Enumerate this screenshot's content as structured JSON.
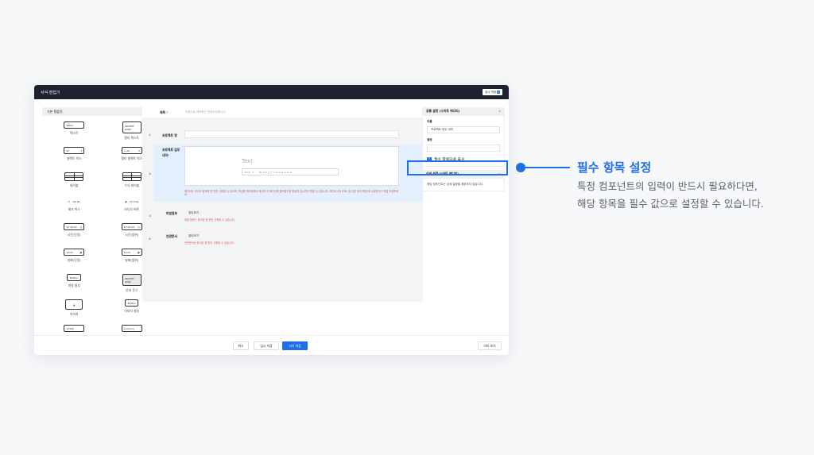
{
  "window": {
    "title": "서식 편집기",
    "top_button": {
      "label": "임시 저장",
      "badge": "0"
    }
  },
  "left_panel": {
    "title": "기본 템플릿",
    "components": [
      {
        "icon_text": "ABCD",
        "label": "텍스트"
      },
      {
        "icon_text": "ABCDEF GHIJK",
        "label": "멀티 텍스트"
      },
      {
        "icon_text": "All",
        "label": "셀렉트 박스"
      },
      {
        "icon_text": "All",
        "label": "멀티 셀렉트 박스"
      },
      {
        "icon_text": "",
        "label": "테이블"
      },
      {
        "icon_text": "",
        "label": "수식 테이블"
      },
      {
        "icon_text": "Yes  No",
        "label": "체크 박스"
      },
      {
        "icon_text": "All  Only",
        "label": "라디오 버튼"
      },
      {
        "icon_text": "12:30:00",
        "label": "시간(단일)"
      },
      {
        "icon_text": "12:30:00",
        "label": "시간(범위)"
      },
      {
        "icon_text": "12/31",
        "label": "날짜(단일)"
      },
      {
        "icon_text": "12/31",
        "label": "날짜(범위)"
      },
      {
        "icon_text": "Button",
        "label": "파일 첨부"
      },
      {
        "icon_text": "ABCDEF GHIJK",
        "label": "안내 문구"
      },
      {
        "icon_text": "",
        "label": "이미지"
      },
      {
        "icon_text": "Button",
        "label": "이미지 첨부"
      },
      {
        "icon_text": "1234$",
        "label": ""
      },
      {
        "icon_text": "Currency",
        "label": ""
      }
    ]
  },
  "form": {
    "title_label": "제목",
    "title_required": "*",
    "title_placeholder": "지원으로 제목부는 표현으로합니다.",
    "rows": [
      {
        "num": "①",
        "label": "프로젝트 명"
      },
      {
        "num": "②",
        "label": "프로젝트 업무 내역",
        "required": "*"
      },
      {
        "num": "③",
        "label": "파일첨부",
        "button": "찾아보기"
      },
      {
        "num": "④",
        "label": "연관문서",
        "button": "찾아보기"
      }
    ],
    "editor_placeholder": "Text",
    "toolbar_font": "Font",
    "toolbar_glyphs": "B  I  U  S  A  ↶  ↷      ≡  ≡  ≡  ≡  ≡  ≡",
    "warnings": {
      "editor": "에디터는 미니어 옵셔에 한 편민 사용할 수 있으며, 작성한 에디터에서 에시판 이 에디터에 클릭방지된 항공의 입니까만 원합 수 있습니다. 에디터 내 HTML 및 다른 형식 확장 후 수정하거나 작업 작성하세요.",
      "file": "파일 첨부는 문서당 한 번만 사용할 수 있습니다.",
      "related": "연관문서는 문서당 한 번만 사용할 수 있습니다."
    }
  },
  "bottom": {
    "cancel": "취소",
    "temp_save": "임시 저장",
    "save": "서식 저장",
    "preview": "미리 보기"
  },
  "right_panel": {
    "section1_title": "공통 설정 (스마트 에디터)",
    "name_label": "이름",
    "name_value": "프로젝트 업무 내역",
    "desc_label": "설명",
    "required_checkbox": "필수 항목으로 표시",
    "section2_title": "상세 설정(스마트 에디터)",
    "section2_text": "해당 컴포넌트는 상세 설정을 제공하지 않습니다."
  },
  "annotation": {
    "title": "필수 항목 설정",
    "line1": "특정 컴포넌트의 입력이 반드시 필요하다면,",
    "line2": "해당 항목을 필수 값으로 설정할 수 있습니다."
  },
  "colors": {
    "accent": "#1f6fe8",
    "titlebar": "#1c2230",
    "warning": "#d9534f",
    "highlight": "#e3effd"
  }
}
